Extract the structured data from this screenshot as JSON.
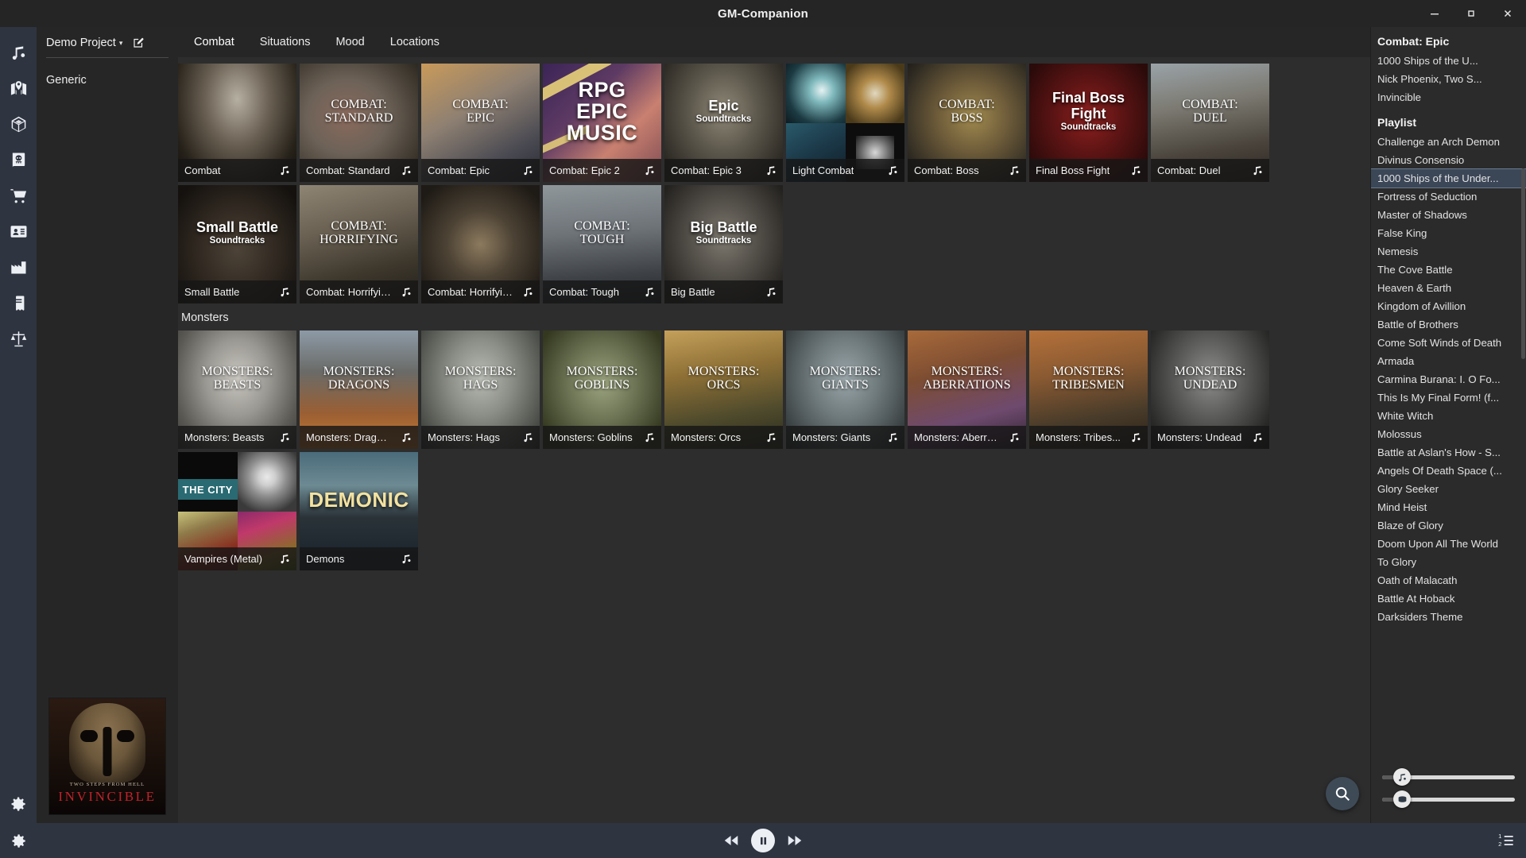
{
  "window": {
    "title": "GM-Companion",
    "minimize_label": "—",
    "maximize_label": "□",
    "close_label": "✕"
  },
  "rail": {
    "items": [
      {
        "name": "music",
        "icon": "music-note-icon"
      },
      {
        "name": "maps",
        "icon": "map-icon"
      },
      {
        "name": "dice",
        "icon": "dice-icon"
      },
      {
        "name": "bestiary",
        "icon": "skull-book-icon"
      },
      {
        "name": "shop",
        "icon": "shopping-cart-icon"
      },
      {
        "name": "characters",
        "icon": "id-card-icon"
      },
      {
        "name": "generator",
        "icon": "factory-icon"
      },
      {
        "name": "notes",
        "icon": "book-icon"
      },
      {
        "name": "converter",
        "icon": "scales-icon"
      }
    ],
    "bottom": {
      "name": "settings",
      "icon": "gear-icon"
    }
  },
  "project": {
    "name": "Demo Project",
    "caret": "▾",
    "edit_icon": "edit-pencil-icon",
    "items": [
      {
        "label": "Generic"
      }
    ],
    "now_playing_art": {
      "artist": "TWO STEPS FROM HELL",
      "title": "INVINCIBLE"
    }
  },
  "tabs": [
    {
      "label": "Combat",
      "active": true
    },
    {
      "label": "Situations",
      "active": false
    },
    {
      "label": "Mood",
      "active": false
    },
    {
      "label": "Locations",
      "active": false
    }
  ],
  "sections": [
    {
      "title": "",
      "cards": [
        {
          "label": "Combat",
          "overlay": "",
          "overlay_sub": "",
          "style": "serif",
          "thumb": "t-combat"
        },
        {
          "label": "Combat: Standard",
          "overlay": "COMBAT:\nSTANDARD",
          "overlay_sub": "",
          "style": "serif",
          "thumb": "t-standard"
        },
        {
          "label": "Combat: Epic",
          "overlay": "COMBAT:\nEPIC",
          "overlay_sub": "",
          "style": "serif",
          "thumb": "t-epic"
        },
        {
          "label": "Combat: Epic 2",
          "overlay": "RPG\nEPIC\nMUSIC",
          "overlay_sub": "",
          "style": "huge",
          "thumb": "t-epic2"
        },
        {
          "label": "Combat: Epic 3",
          "overlay": "Epic",
          "overlay_sub": "Soundtracks",
          "style": "bold",
          "thumb": "t-epic3"
        },
        {
          "label": "Light Combat",
          "overlay": "",
          "overlay_sub": "",
          "style": "grid-light",
          "thumb": "t-light"
        },
        {
          "label": "Combat: Boss",
          "overlay": "COMBAT:\nBOSS",
          "overlay_sub": "",
          "style": "serif",
          "thumb": "t-boss"
        },
        {
          "label": "Final Boss Fight",
          "overlay": "Final Boss Fight",
          "overlay_sub": "Soundtracks",
          "style": "bold",
          "thumb": "t-finalb"
        },
        {
          "label": "Combat: Duel",
          "overlay": "COMBAT:\nDUEL",
          "overlay_sub": "",
          "style": "serif",
          "thumb": "t-duel"
        },
        {
          "label": "Small Battle",
          "overlay": "Small Battle",
          "overlay_sub": "Soundtracks",
          "style": "bold",
          "thumb": "t-small"
        },
        {
          "label": "Combat: Horrifying",
          "overlay": "COMBAT:\nHORRIFYING",
          "overlay_sub": "",
          "style": "serif",
          "thumb": "t-horr"
        },
        {
          "label": "Combat: Horrifyin...",
          "overlay": "",
          "overlay_sub": "",
          "style": "serif",
          "thumb": "t-horr2"
        },
        {
          "label": "Combat: Tough",
          "overlay": "COMBAT:\nTOUGH",
          "overlay_sub": "",
          "style": "serif",
          "thumb": "t-tough"
        },
        {
          "label": "Big Battle",
          "overlay": "Big Battle",
          "overlay_sub": "Soundtracks",
          "style": "bold",
          "thumb": "t-big"
        }
      ]
    },
    {
      "title": "Monsters",
      "cards": [
        {
          "label": "Monsters: Beasts",
          "overlay": "MONSTERS:\nBEASTS",
          "overlay_sub": "",
          "style": "serif",
          "thumb": "t-beasts"
        },
        {
          "label": "Monsters: Dragons",
          "overlay": "MONSTERS:\nDRAGONS",
          "overlay_sub": "",
          "style": "serif",
          "thumb": "t-dragons"
        },
        {
          "label": "Monsters: Hags",
          "overlay": "MONSTERS:\nHAGS",
          "overlay_sub": "",
          "style": "serif",
          "thumb": "t-hags"
        },
        {
          "label": "Monsters: Goblins",
          "overlay": "MONSTERS:\nGOBLINS",
          "overlay_sub": "",
          "style": "serif",
          "thumb": "t-goblins"
        },
        {
          "label": "Monsters: Orcs",
          "overlay": "MONSTERS:\nORCS",
          "overlay_sub": "",
          "style": "serif",
          "thumb": "t-orcs"
        },
        {
          "label": "Monsters: Giants",
          "overlay": "MONSTERS:\nGIANTS",
          "overlay_sub": "",
          "style": "serif",
          "thumb": "t-giants"
        },
        {
          "label": "Monsters: Aberrat...",
          "overlay": "MONSTERS:\nABERRATIONS",
          "overlay_sub": "",
          "style": "serif",
          "thumb": "t-aberr"
        },
        {
          "label": "Monsters: Tribes...",
          "overlay": "MONSTERS:\nTRIBESMEN",
          "overlay_sub": "",
          "style": "serif",
          "thumb": "t-tribes"
        },
        {
          "label": "Monsters: Undead",
          "overlay": "MONSTERS:\nUNDEAD",
          "overlay_sub": "",
          "style": "serif",
          "thumb": "t-undead"
        },
        {
          "label": "Vampires (Metal)",
          "overlay": "",
          "overlay_sub": "",
          "style": "grid-vamp",
          "thumb": "t-vamp",
          "band": "THE CITY"
        },
        {
          "label": "Demons",
          "overlay": "DEMONIC",
          "overlay_sub": "",
          "style": "demonic",
          "thumb": "t-demons"
        }
      ]
    }
  ],
  "search_fab": {
    "icon": "search-icon"
  },
  "right_panel": {
    "now_playing_header": "Combat: Epic",
    "now_playing": [
      "1000 Ships of the U...",
      "Nick Phoenix, Two S...",
      "Invincible"
    ],
    "playlist_header": "Playlist",
    "playlist": [
      {
        "label": "Challenge an Arch Demon",
        "selected": false
      },
      {
        "label": "Divinus Consensio",
        "selected": false
      },
      {
        "label": "1000 Ships of the Under...",
        "selected": true
      },
      {
        "label": "Fortress of Seduction",
        "selected": false
      },
      {
        "label": "Master of Shadows",
        "selected": false
      },
      {
        "label": "False King",
        "selected": false
      },
      {
        "label": "Nemesis",
        "selected": false
      },
      {
        "label": "The Cove Battle",
        "selected": false
      },
      {
        "label": "Heaven & Earth",
        "selected": false
      },
      {
        "label": "Kingdom of Avillion",
        "selected": false
      },
      {
        "label": "Battle of Brothers",
        "selected": false
      },
      {
        "label": "Come Soft Winds of Death",
        "selected": false
      },
      {
        "label": "Armada",
        "selected": false
      },
      {
        "label": "Carmina Burana: I. O Fo...",
        "selected": false
      },
      {
        "label": "This Is My Final Form! (f...",
        "selected": false
      },
      {
        "label": "White Witch",
        "selected": false
      },
      {
        "label": "Molossus",
        "selected": false
      },
      {
        "label": "Battle at Aslan's How - S...",
        "selected": false
      },
      {
        "label": "Angels Of Death Space (...",
        "selected": false
      },
      {
        "label": "Glory Seeker",
        "selected": false
      },
      {
        "label": "Mind Heist",
        "selected": false
      },
      {
        "label": "Blaze of Glory",
        "selected": false
      },
      {
        "label": "Doom Upon All The World",
        "selected": false
      },
      {
        "label": "To Glory",
        "selected": false
      },
      {
        "label": "Oath of Malacath",
        "selected": false
      },
      {
        "label": "Battle At Hoback",
        "selected": false
      },
      {
        "label": "Darksiders Theme",
        "selected": false
      }
    ],
    "sliders": [
      {
        "name": "music-volume",
        "icon": "music-note-icon",
        "value": 14
      },
      {
        "name": "sound-volume",
        "icon": "drum-icon",
        "value": 14
      }
    ]
  },
  "player": {
    "settings_icon": "gear-icon",
    "prev_label": "rewind-icon",
    "play_label": "pause-icon",
    "next_label": "forward-icon",
    "queue_label": "queue-list-icon"
  },
  "colors": {
    "accent": "#3b4657",
    "rail": "#2e3440",
    "panel": "#2b2b2b",
    "canvas": "#2d2d2d",
    "titlebar": "#252525"
  }
}
